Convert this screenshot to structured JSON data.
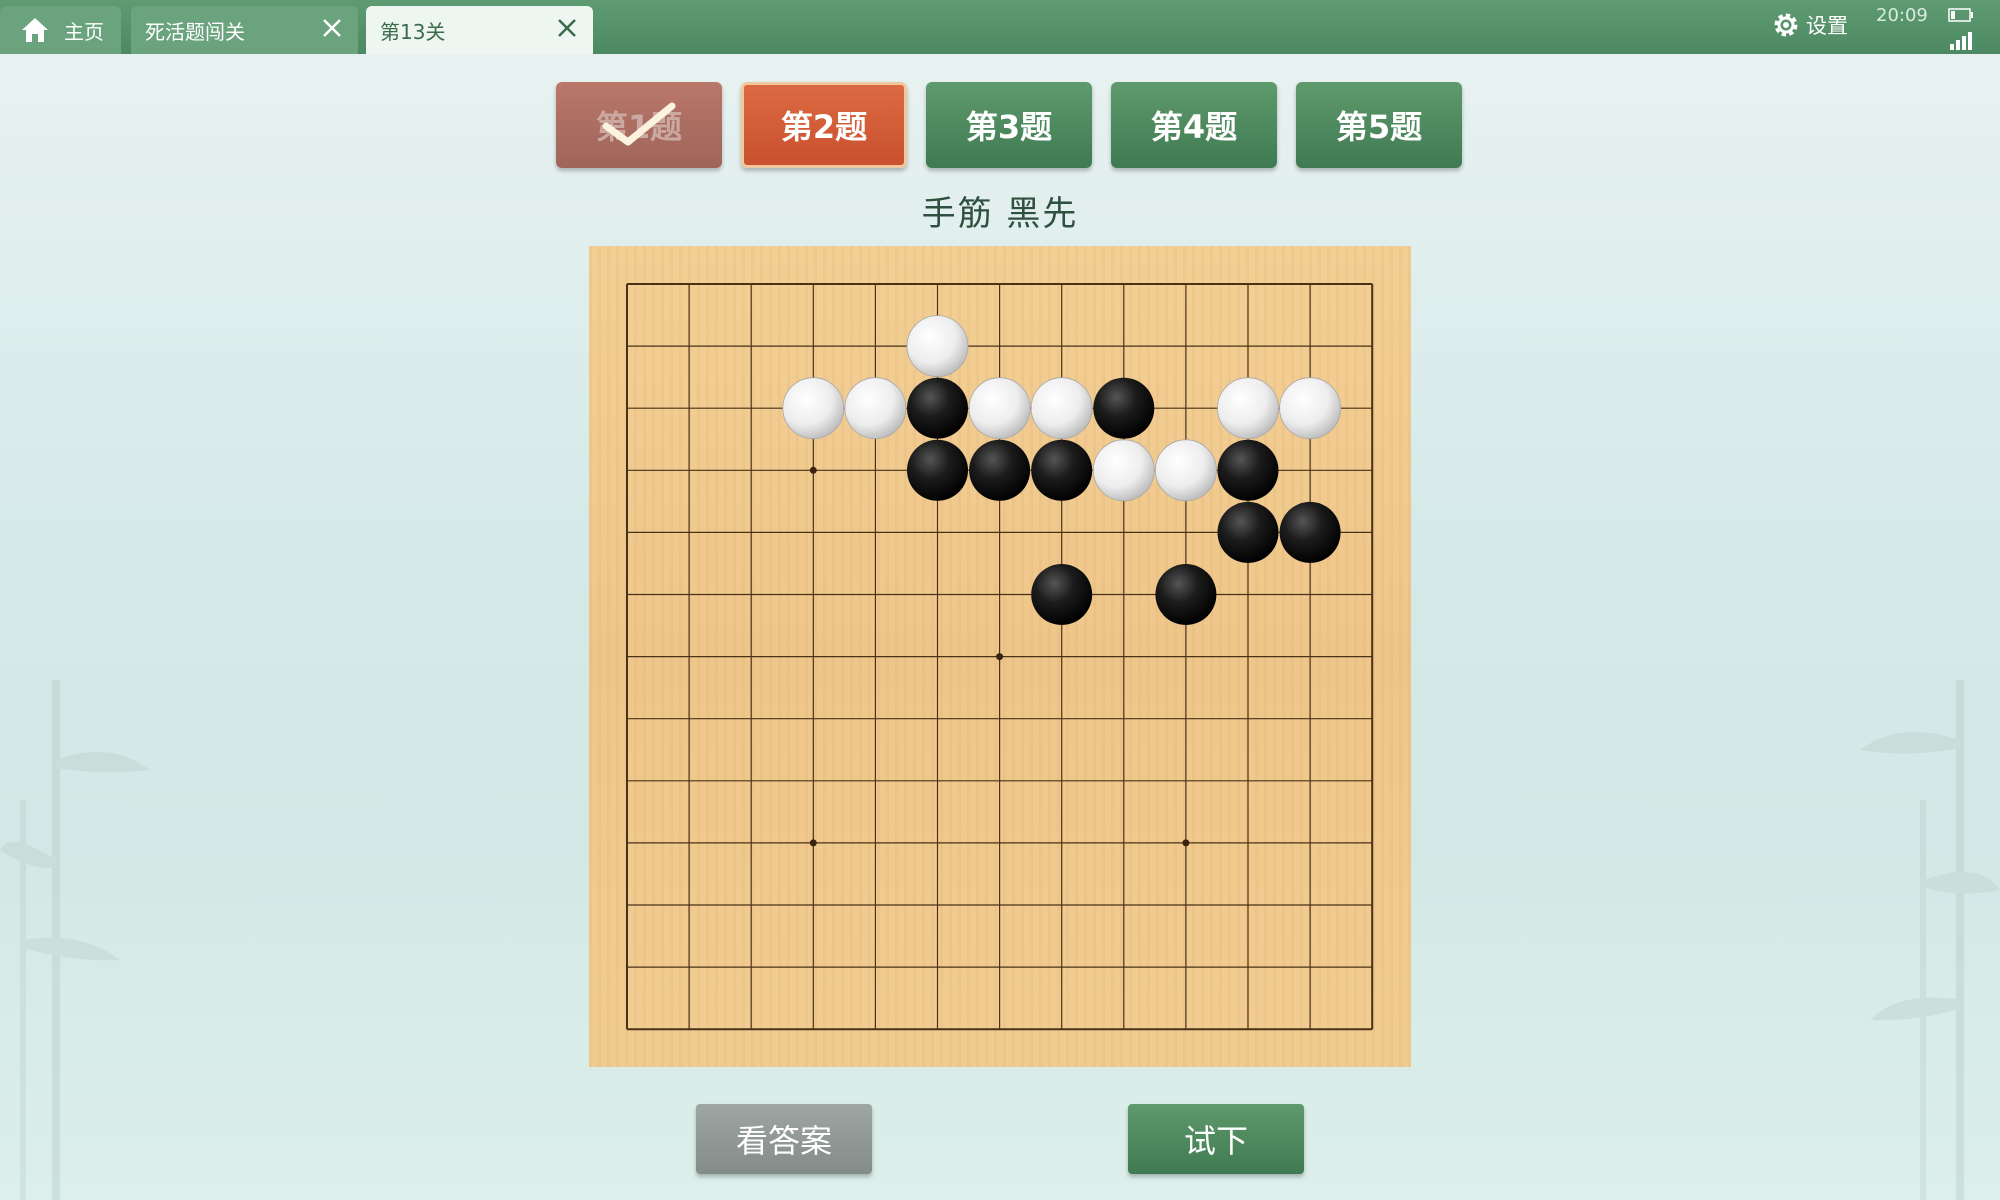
{
  "tabs": [
    {
      "label": "主页",
      "icon": "home-icon"
    },
    {
      "label": "死活题闯关",
      "icon": "close-icon"
    },
    {
      "label": "第13关",
      "icon": "close-icon"
    }
  ],
  "status": {
    "settings_label": "设置",
    "time": "20:09"
  },
  "problems": [
    {
      "label": "第1题",
      "state": "done"
    },
    {
      "label": "第2题",
      "state": "current"
    },
    {
      "label": "第3题",
      "state": "default"
    },
    {
      "label": "第4题",
      "state": "default"
    },
    {
      "label": "第5题",
      "state": "default"
    }
  ],
  "subtitle": "手筋   黑先",
  "board": {
    "size": 13,
    "star_points": [
      [
        3,
        3
      ],
      [
        6,
        6
      ],
      [
        3,
        9
      ],
      [
        9,
        9
      ]
    ],
    "stones": [
      {
        "color": "white",
        "col": 5,
        "row": 1
      },
      {
        "color": "white",
        "col": 3,
        "row": 2
      },
      {
        "color": "white",
        "col": 4,
        "row": 2
      },
      {
        "color": "black",
        "col": 5,
        "row": 2
      },
      {
        "color": "white",
        "col": 6,
        "row": 2
      },
      {
        "color": "white",
        "col": 7,
        "row": 2
      },
      {
        "color": "black",
        "col": 8,
        "row": 2
      },
      {
        "color": "white",
        "col": 10,
        "row": 2
      },
      {
        "color": "white",
        "col": 11,
        "row": 2
      },
      {
        "color": "black",
        "col": 5,
        "row": 3
      },
      {
        "color": "black",
        "col": 6,
        "row": 3
      },
      {
        "color": "black",
        "col": 7,
        "row": 3
      },
      {
        "color": "white",
        "col": 8,
        "row": 3
      },
      {
        "color": "white",
        "col": 9,
        "row": 3
      },
      {
        "color": "black",
        "col": 10,
        "row": 3
      },
      {
        "color": "black",
        "col": 10,
        "row": 4
      },
      {
        "color": "black",
        "col": 11,
        "row": 4
      },
      {
        "color": "black",
        "col": 7,
        "row": 5
      },
      {
        "color": "black",
        "col": 9,
        "row": 5
      }
    ]
  },
  "actions": {
    "answer_label": "看答案",
    "try_label": "试下"
  }
}
